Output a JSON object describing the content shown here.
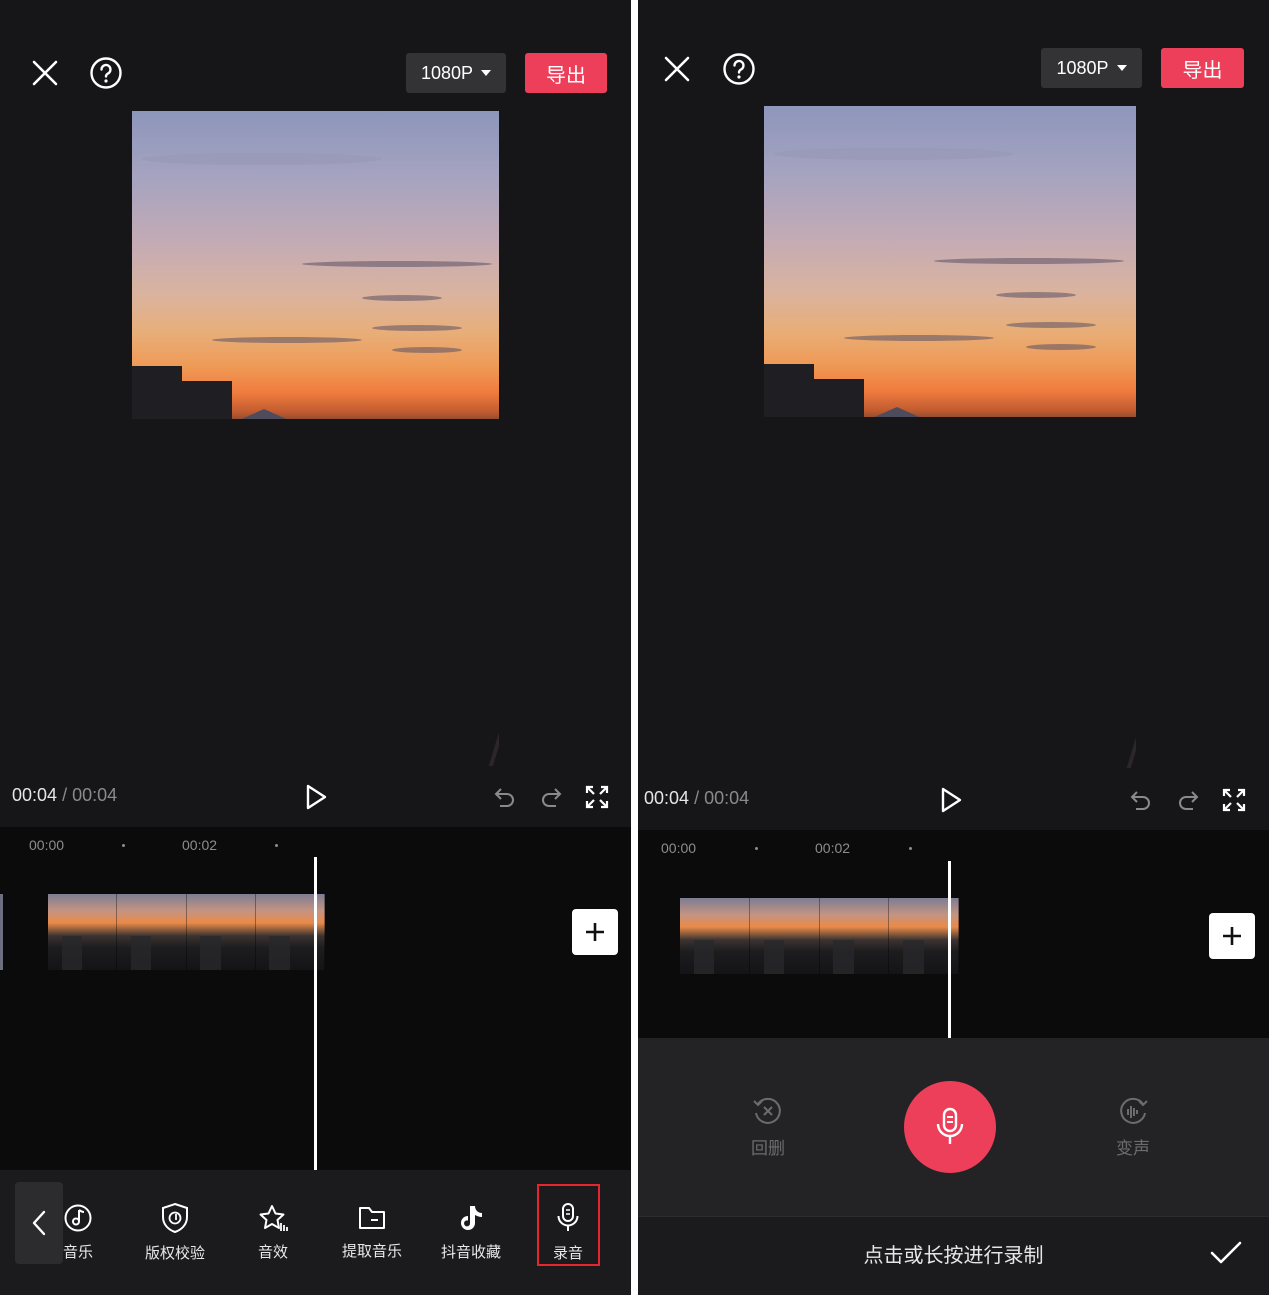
{
  "left": {
    "resolution": "1080P",
    "export_label": "导出",
    "time_current": "00:04",
    "time_separator": "/",
    "time_total": "00:04",
    "timeline_ticks": [
      "00:00",
      "00:02"
    ],
    "tools": [
      {
        "label": "音乐",
        "icon": "music-note-icon"
      },
      {
        "label": "版权校验",
        "icon": "copyright-shield-icon"
      },
      {
        "label": "音效",
        "icon": "sound-effect-star-icon"
      },
      {
        "label": "提取音乐",
        "icon": "folder-icon"
      },
      {
        "label": "抖音收藏",
        "icon": "tiktok-icon"
      },
      {
        "label": "录音",
        "icon": "microphone-icon",
        "highlighted": true
      }
    ]
  },
  "right": {
    "resolution": "1080P",
    "export_label": "导出",
    "time_current": "00:04",
    "time_separator": "/",
    "time_total": "00:04",
    "timeline_ticks": [
      "00:00",
      "00:02"
    ],
    "undo_label": "回删",
    "voice_change_label": "变声",
    "record_hint": "点击或长按进行录制"
  },
  "colors": {
    "accent": "#ee3f5a",
    "highlight_box": "#e5262e",
    "background": "#161618",
    "timeline_bg": "#0b0b0c"
  }
}
